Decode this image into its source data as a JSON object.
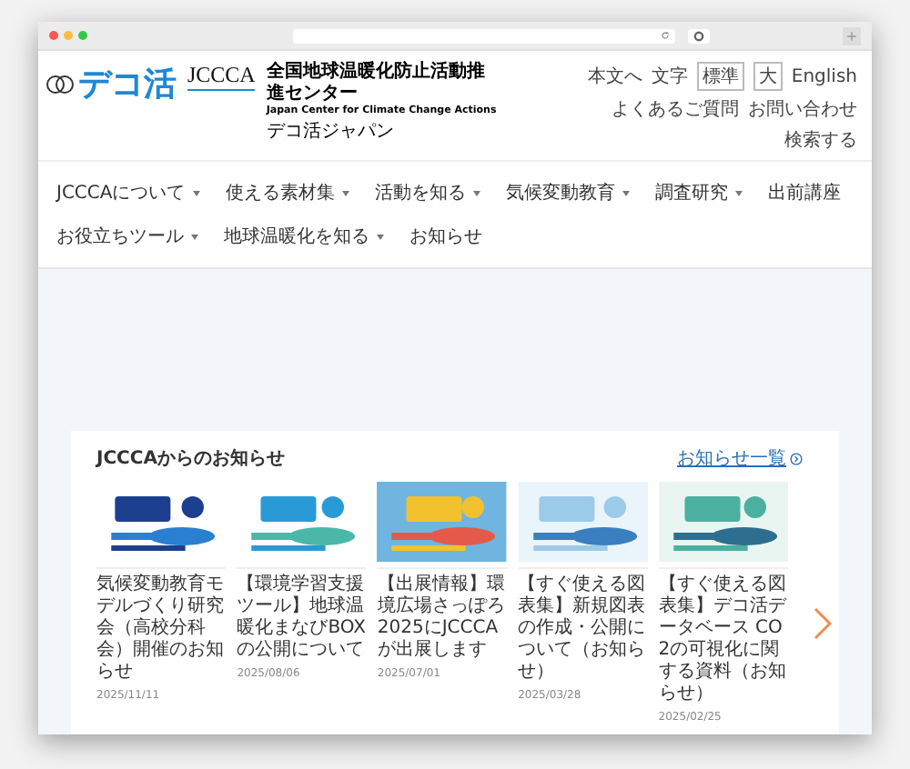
{
  "header": {
    "logo_text": "デコ活",
    "logo_mark": "JCCCA",
    "org_name": "全国地球温暖化防止活動推進センター",
    "org_name_en": "Japan Center for Climate Change Actions",
    "tagline": "デコ活ジャパン",
    "utility_links": [
      {
        "label": "本文へ",
        "kind": "link"
      },
      {
        "label": "文字",
        "kind": "label"
      },
      {
        "label": "標準",
        "kind": "toggle"
      },
      {
        "label": "大",
        "kind": "toggle"
      },
      {
        "label": "English",
        "kind": "link"
      },
      {
        "label": "よくあるご質問",
        "kind": "link"
      },
      {
        "label": "お問い合わせ",
        "kind": "link"
      },
      {
        "label": "検索する",
        "kind": "link"
      }
    ]
  },
  "nav": [
    {
      "label": "JCCCAについて",
      "has_menu": true
    },
    {
      "label": "使える素材集",
      "has_menu": true
    },
    {
      "label": "活動を知る",
      "has_menu": true
    },
    {
      "label": "気候変動教育",
      "has_menu": true
    },
    {
      "label": "調査研究",
      "has_menu": true
    },
    {
      "label": "出前講座",
      "has_menu": false
    },
    {
      "label": "お役立ちツール",
      "has_menu": true
    },
    {
      "label": "地球温暖化を知る",
      "has_menu": true
    },
    {
      "label": "お知らせ",
      "has_menu": false
    }
  ],
  "news": {
    "title": "JCCCAからのお知らせ",
    "more_link": "お知らせ一覧",
    "items": [
      {
        "title": "気候変動教育モデルづくり研究会（高校分科会）開催のお知らせ",
        "date": "2025/11/11"
      },
      {
        "title": "【環境学習支援ツール】地球温暖化まなびBOXの公開について",
        "date": "2025/08/06"
      },
      {
        "title": "【出展情報】環境広場さっぽろ2025にJCCCAが出展します",
        "date": "2025/07/01"
      },
      {
        "title": "【すぐ使える図表集】新規図表の作成・公開について（お知らせ）",
        "date": "2025/03/28"
      },
      {
        "title": "【すぐ使える図表集】デコ活データベース CO2の可視化に関する資料（お知らせ）",
        "date": "2025/02/25"
      }
    ]
  }
}
